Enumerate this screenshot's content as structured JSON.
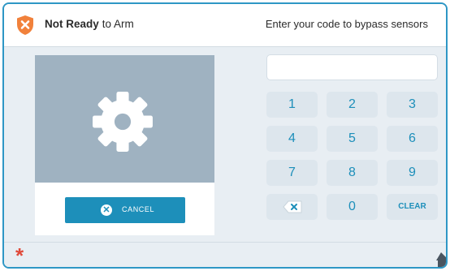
{
  "header": {
    "status_bold": "Not Ready",
    "status_rest": "to Arm",
    "prompt": "Enter your code to bypass sensors"
  },
  "camera": {
    "icon": "gear-icon",
    "cancel_label": "CANCEL"
  },
  "keypad": {
    "code_value": "",
    "keys": [
      "1",
      "2",
      "3",
      "4",
      "5",
      "6",
      "7",
      "8",
      "9",
      "",
      "0",
      "CLEAR"
    ]
  },
  "footer": {
    "asterisk": "*"
  },
  "colors": {
    "accent": "#1d8fba",
    "frame": "#2e97c5",
    "warning": "#f1813b",
    "emergency": "#e04a3a"
  }
}
